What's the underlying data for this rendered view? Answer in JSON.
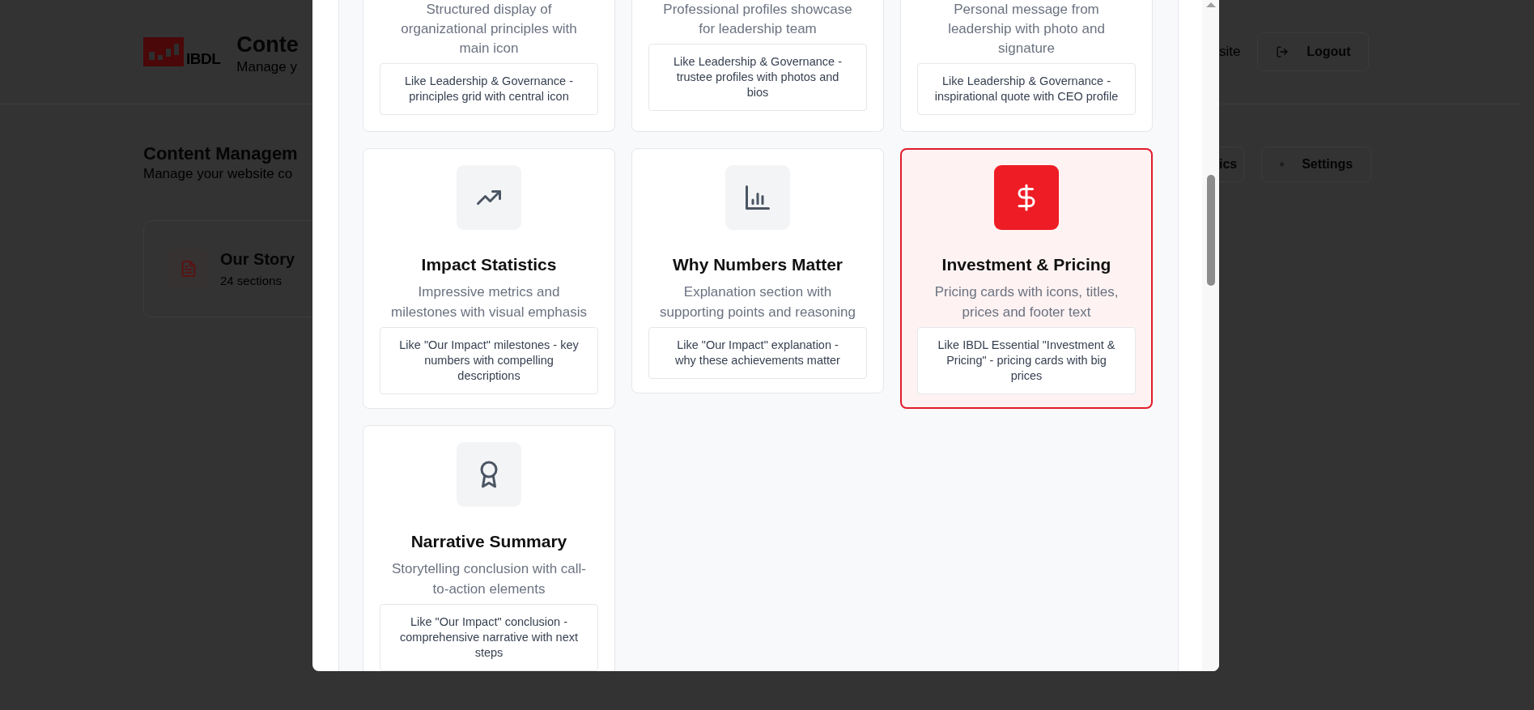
{
  "background": {
    "header": {
      "logo_text": "IBDL",
      "title": "Conte",
      "subtitle": "Manage y",
      "link": "site",
      "logout": "Logout"
    },
    "section": {
      "title": "Content Managem",
      "subtitle": "Manage your website co",
      "buttons": [
        "ics",
        "Settings"
      ]
    },
    "page_card": {
      "title": "Our Story",
      "meta": "24 sections"
    }
  },
  "modal": {
    "templates": [
      {
        "description": "Structured display of organizational principles with main icon",
        "example": "Like Leadership & Governance - principles grid with central icon",
        "selected": false
      },
      {
        "description": "Professional profiles showcase for leadership team",
        "example": "Like Leadership & Governance - trustee profiles with photos and bios",
        "selected": false
      },
      {
        "description": "Personal message from leadership with photo and signature",
        "example": "Like Leadership & Governance - inspirational quote with CEO profile",
        "selected": false
      },
      {
        "title": "Impact Statistics",
        "description": "Impressive metrics and milestones with visual emphasis",
        "example": "Like \"Our Impact\" milestones - key numbers with compelling descriptions",
        "selected": false
      },
      {
        "title": "Why Numbers Matter",
        "description": "Explanation section with supporting points and reasoning",
        "example": "Like \"Our Impact\" explanation - why these achievements matter",
        "selected": false
      },
      {
        "title": "Investment & Pricing",
        "description": "Pricing cards with icons, titles, prices and footer text",
        "example": "Like IBDL Essential \"Investment & Pricing\" - pricing cards with big prices",
        "selected": true
      },
      {
        "title": "Narrative Summary",
        "description": "Storytelling conclusion with call-to-action elements",
        "example": "Like \"Our Impact\" conclusion - comprehensive narrative with next steps",
        "selected": false
      }
    ]
  }
}
